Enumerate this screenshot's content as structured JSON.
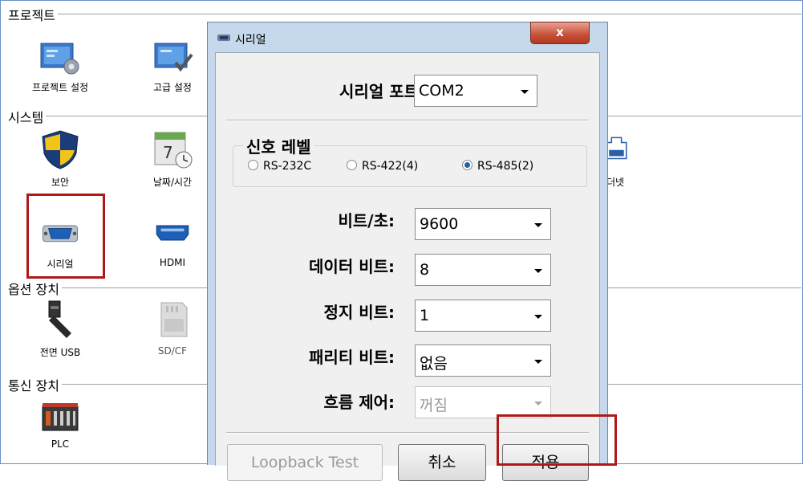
{
  "sections": {
    "project": "프로젝트",
    "system": "시스템",
    "options": "옵션 장치",
    "comm": "통신 장치"
  },
  "items": {
    "project_settings": "프로젝트 설정",
    "advanced_settings": "고급 설정",
    "security": "보안",
    "datetime": "날짜/시간",
    "ethernet_partial": "더넷",
    "serial": "시리얼",
    "hdmi": "HDMI",
    "front_usb": "전면 USB",
    "sdcf": "SD/CF",
    "plc": "PLC"
  },
  "dialog": {
    "title": "시리얼",
    "close": "x",
    "serial_port_label": "시리얼 포트",
    "serial_port_value": "COM2",
    "signal_level_label": "신호 레벨",
    "radios": [
      "RS-232C",
      "RS-422(4)",
      "RS-485(2)"
    ],
    "selected_radio": 2,
    "baud_label": "비트/초:",
    "baud_value": "9600",
    "databits_label": "데이터 비트:",
    "databits_value": "8",
    "stopbits_label": "정지 비트:",
    "stopbits_value": "1",
    "parity_label": "패리티 비트:",
    "parity_value": "없음",
    "flow_label": "흐름 제어:",
    "flow_value": "꺼짐",
    "loopback_button": "Loopback Test",
    "cancel_button": "취소",
    "apply_button": "적용"
  }
}
